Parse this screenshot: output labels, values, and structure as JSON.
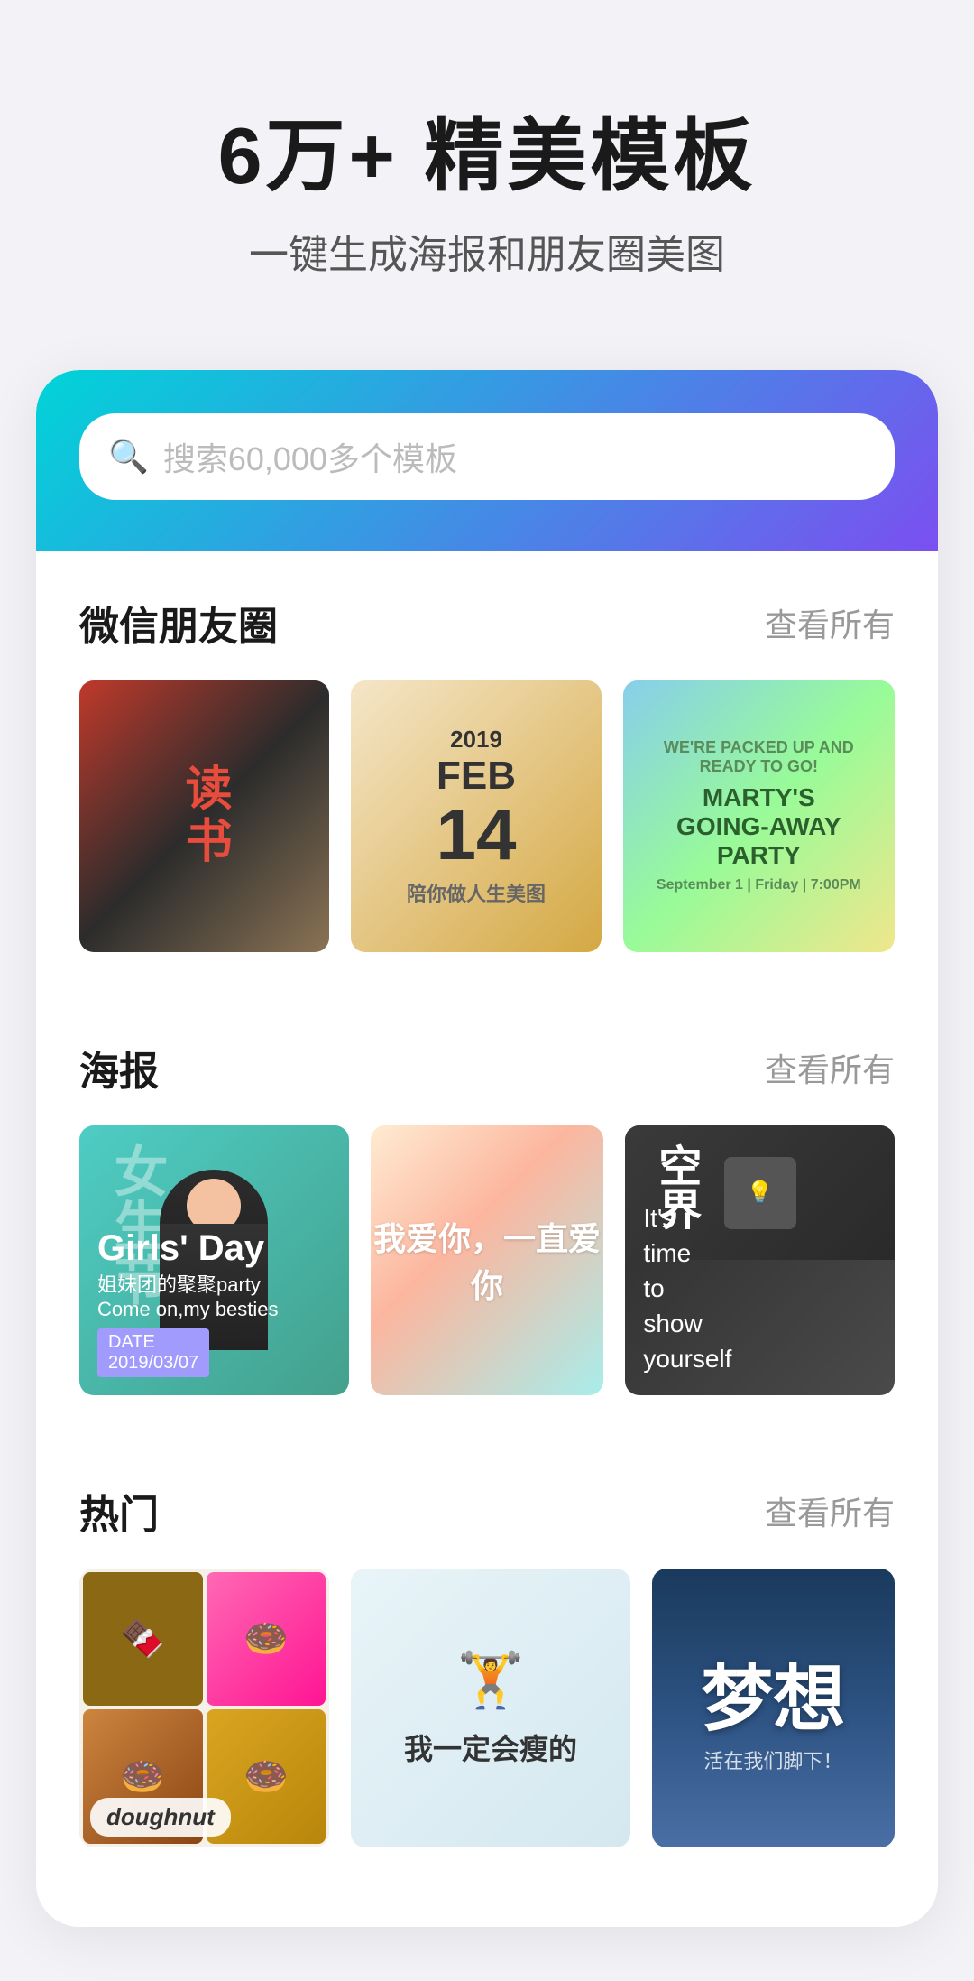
{
  "hero": {
    "title": "6万+ 精美模板",
    "subtitle": "一键生成海报和朋友圈美图"
  },
  "search": {
    "placeholder": "搜索60,000多个模板"
  },
  "sections": [
    {
      "id": "wechat",
      "title": "微信朋友圈",
      "view_all": "查看所有",
      "cards": [
        {
          "type": "reading",
          "label": "读书"
        },
        {
          "type": "feb14",
          "year": "2019",
          "month": "FEB",
          "day": "14",
          "sub": "陪你做人生美图"
        },
        {
          "type": "party",
          "text": "MARTY'S GOING-AWAY PARTY"
        }
      ]
    },
    {
      "id": "poster",
      "title": "海报",
      "view_all": "查看所有",
      "cards": [
        {
          "type": "girlsday",
          "main": "Girls' Day",
          "sub": "姐妹团的聚聚party\nCome on,my besties",
          "date": "DATE 2019/03/07"
        },
        {
          "type": "love",
          "text": "我爱你，一直爱你"
        },
        {
          "type": "dark",
          "title": "空界",
          "sub": "It's time to show yourself"
        }
      ]
    },
    {
      "id": "hot",
      "title": "热门",
      "view_all": "查看所有",
      "cards": [
        {
          "type": "doughnut",
          "label": "doughnut"
        },
        {
          "type": "motivation",
          "text": "我一定会瘦的"
        },
        {
          "type": "dream",
          "char": "梦想",
          "sub": "活在我们脚下！"
        }
      ]
    }
  ]
}
